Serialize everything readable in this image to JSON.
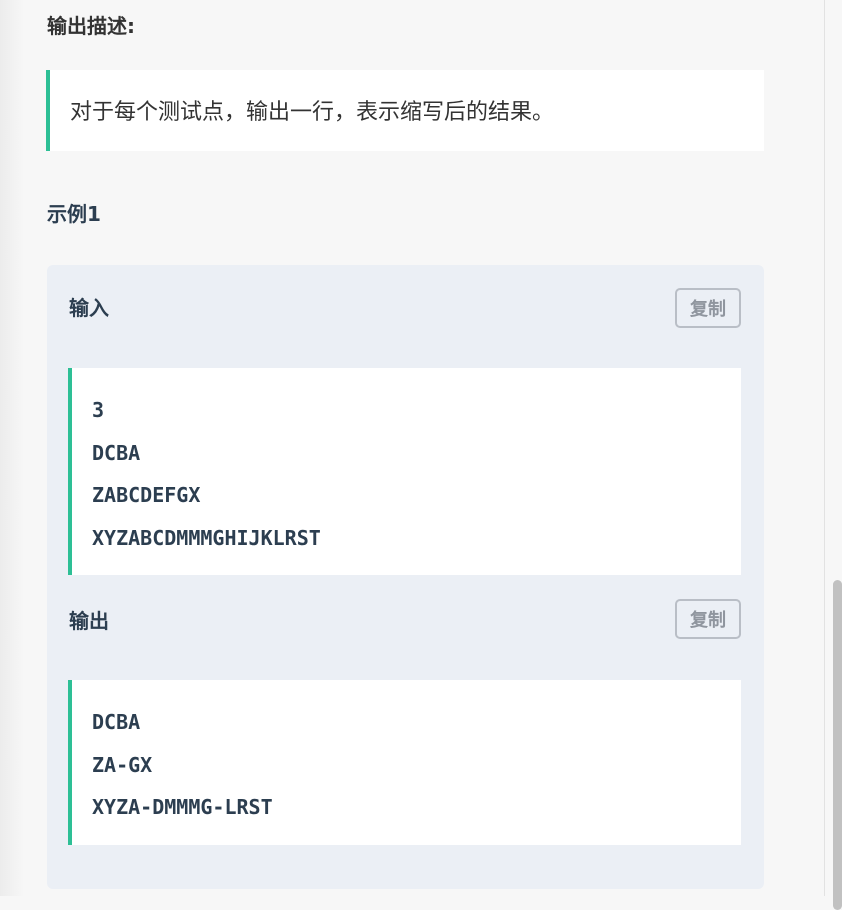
{
  "output_description": {
    "heading": "输出描述:",
    "text": "对于每个测试点，输出一行，表示缩写后的结果。"
  },
  "example": {
    "heading": "示例1",
    "input": {
      "label": "输入",
      "copy_label": "复制",
      "lines": [
        "3",
        "DCBA",
        "ZABCDEFGX",
        "XYZABCDMMMGHIJKLRST"
      ]
    },
    "output": {
      "label": "输出",
      "copy_label": "复制",
      "lines": [
        "DCBA",
        "ZA-GX",
        "XYZA-DMMMG-LRST"
      ]
    }
  },
  "colors": {
    "accent": "#2dbf95",
    "sample_bg": "#ebeff5",
    "text": "#2c3e50"
  }
}
